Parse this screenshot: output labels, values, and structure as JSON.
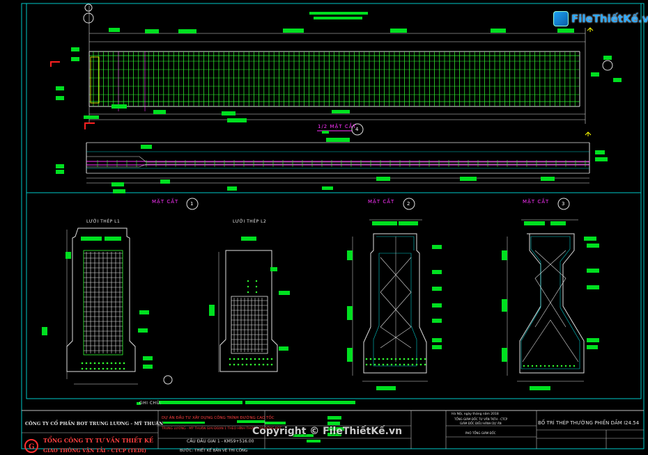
{
  "logo": {
    "text": "FileThiếtKế.vn"
  },
  "watermark": "Copyright © FileThiếtKế.vn",
  "sections": {
    "half_section": "1/2 MẶT CẮT",
    "half_section_no": "4",
    "sec1": "MẶT CẮT",
    "sec1_no": "1",
    "sec2": "MẶT CẮT",
    "sec2_no": "2",
    "sec3": "MẶT CẮT",
    "sec3_no": "3",
    "mesh_l1": "LƯỚI THÉP L1",
    "mesh_l2": "LƯỚI THÉP L2",
    "note_label": "GHI CHÚ:"
  },
  "title_block": {
    "company1": "CÔNG TY CỔ PHẦN BOT TRUNG LƯƠNG - MỸ THUẬN",
    "company2_line1": "TỔNG CÔNG TY TƯ VẤN THIẾT KẾ",
    "company2_line2": "GIAO THÔNG VẬN TẢI - CTCP (TEDI)",
    "project_line1": "DỰ ÁN ĐẦU TƯ XÂY DỰNG CÔNG TRÌNH ĐƯỜNG CAO TỐC",
    "project_line2": "TRUNG LƯƠNG - MỸ THUẬN GIAI ĐOẠN 1 THEO HÌNH THỨC HỢP ĐỒNG BOT",
    "bridge": "CẦU ĐẦU GIAI 1 - KM59+516.00",
    "stage": "BƯỚC: THIẾT KẾ BẢN VẼ THI CÔNG",
    "date_line": "Hà Nội, ngày       tháng        năm 2018",
    "director1": "TỔNG GIÁM ĐỐC TƯ VẤN TKTH - CTCP",
    "director2": "GIÁM ĐỐC ĐIỀU HÀNH DỰ ÁN",
    "director3": "PHÓ TỔNG GIÁM ĐỐC",
    "drawing_title": "BỐ TRÍ THÉP THƯỜNG PHIẾN DẦM I24.54"
  },
  "colors": {
    "green_text": "#00e020",
    "frame": "#00c8c8",
    "rebar": "#30ff30",
    "magenta": "#ff33ff",
    "white": "#e8e8e8",
    "red": "#ff2020",
    "yellow": "#ffff00"
  }
}
